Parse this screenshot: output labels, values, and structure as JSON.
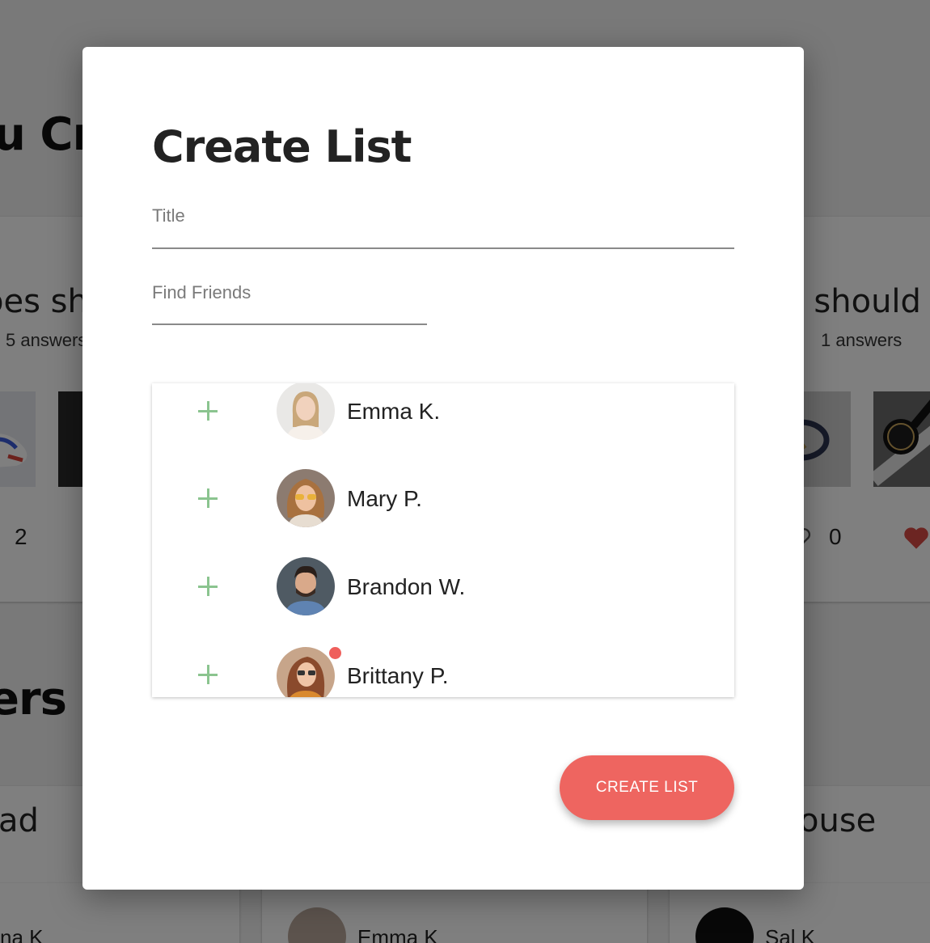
{
  "background": {
    "heading_top": "u Cr",
    "heading_bottom": "ers Li",
    "cards": [
      {
        "title": "oes sh",
        "answers": "5 answers",
        "count": "2"
      },
      {
        "title": "t should I",
        "answers": "1 answers",
        "count": "0"
      }
    ],
    "lower_cards": [
      {
        "title": "ad",
        "person": "na K"
      },
      {
        "title": "",
        "person": "Emma K"
      },
      {
        "title": "ouse",
        "person": "Sal K"
      }
    ]
  },
  "modal": {
    "title": "Create List",
    "title_field": {
      "placeholder": "Title",
      "value": ""
    },
    "find_field": {
      "placeholder": "Find Friends",
      "value": ""
    },
    "friends": [
      {
        "name": "Emma K.",
        "avatar": "avatar-emma",
        "notification": false
      },
      {
        "name": "Mary P.",
        "avatar": "avatar-mary",
        "notification": false
      },
      {
        "name": "Brandon W.",
        "avatar": "avatar-brandon",
        "notification": false
      },
      {
        "name": "Brittany P.",
        "avatar": "avatar-brittany",
        "notification": true
      }
    ],
    "create_button": "CREATE LIST"
  },
  "colors": {
    "accent": "#ee6560",
    "add_icon": "#8bc48f",
    "overlay": "rgba(0,0,0,0.5)"
  }
}
